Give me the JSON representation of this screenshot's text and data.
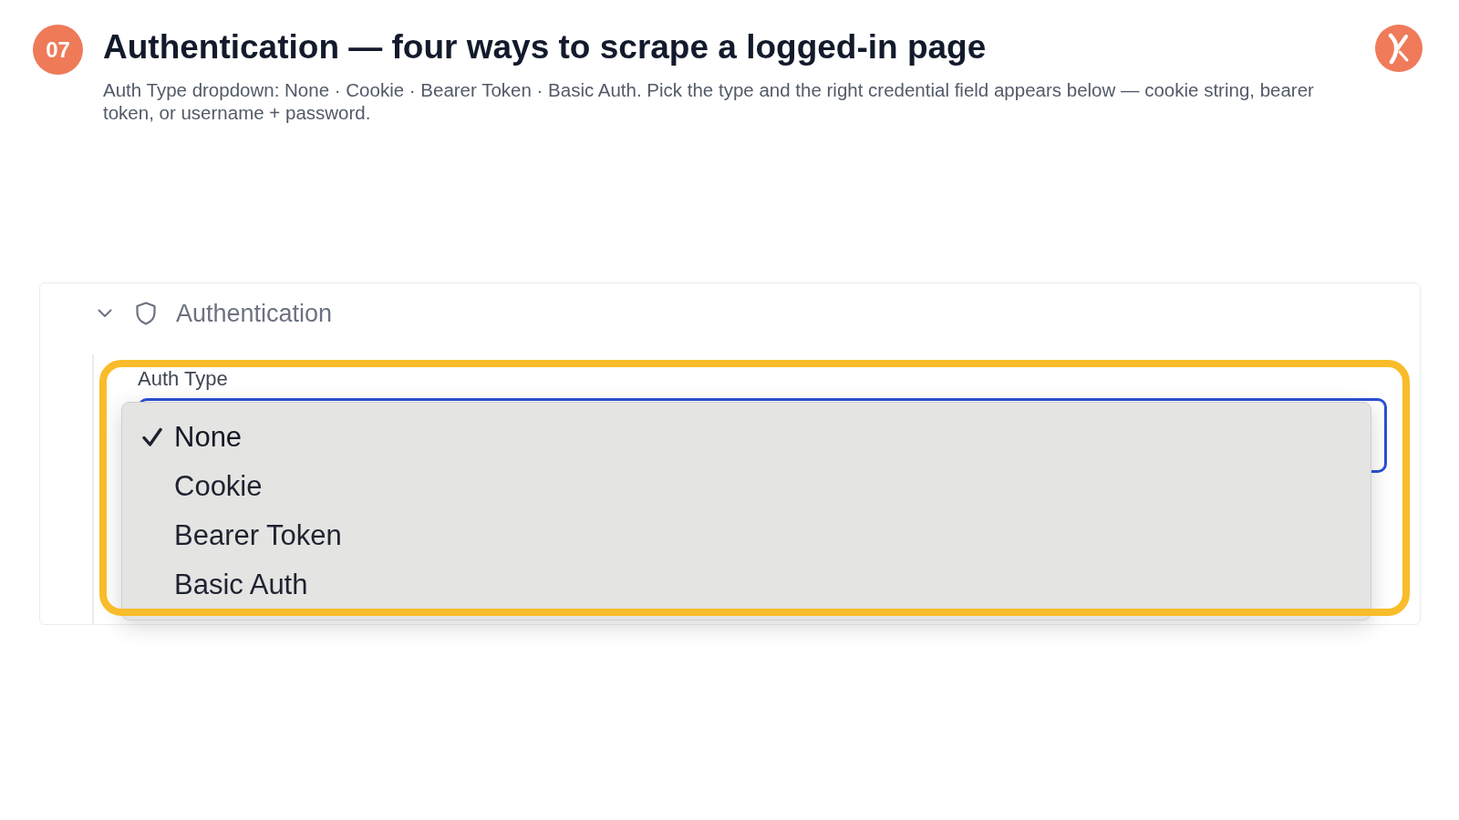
{
  "header": {
    "step": "07",
    "title": "Authentication — four ways to scrape a logged-in page",
    "subtitle": "Auth Type dropdown: None · Cookie · Bearer Token · Basic Auth. Pick the type and the right credential field appears below — cookie string, bearer token, or username + password."
  },
  "section": {
    "title": "Authentication",
    "expanded": true,
    "field": {
      "label": "Auth Type",
      "focused": true,
      "open": true,
      "options": [
        {
          "label": "None",
          "selected": true
        },
        {
          "label": "Cookie",
          "selected": false
        },
        {
          "label": "Bearer Token",
          "selected": false
        },
        {
          "label": "Basic Auth",
          "selected": false
        }
      ]
    }
  }
}
